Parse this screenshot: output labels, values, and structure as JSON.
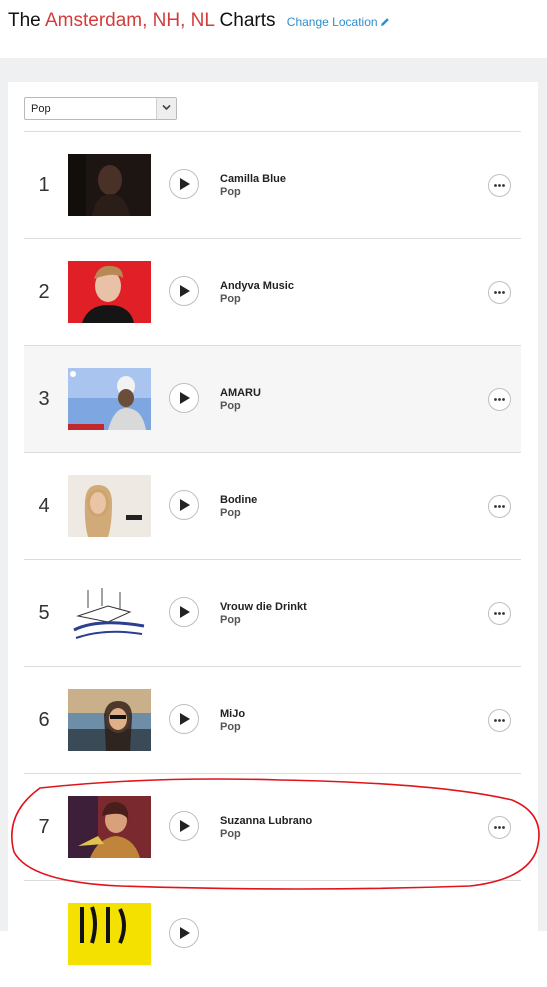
{
  "header": {
    "title_prefix": "The",
    "location": "Amsterdam, NH, NL",
    "title_suffix": "Charts",
    "change_location_label": "Change Location"
  },
  "filter": {
    "selected": "Pop"
  },
  "colors": {
    "accent_red": "#d33c3c",
    "link_blue": "#2a8fd0"
  },
  "chart": [
    {
      "rank": "1",
      "artist": "Camilla Blue",
      "genre": "Pop"
    },
    {
      "rank": "2",
      "artist": "Andyva Music",
      "genre": "Pop"
    },
    {
      "rank": "3",
      "artist": "AMARU",
      "genre": "Pop"
    },
    {
      "rank": "4",
      "artist": "Bodine",
      "genre": "Pop"
    },
    {
      "rank": "5",
      "artist": "Vrouw die Drinkt",
      "genre": "Pop"
    },
    {
      "rank": "6",
      "artist": "MiJo",
      "genre": "Pop"
    },
    {
      "rank": "7",
      "artist": "Suzanna Lubrano",
      "genre": "Pop"
    }
  ]
}
